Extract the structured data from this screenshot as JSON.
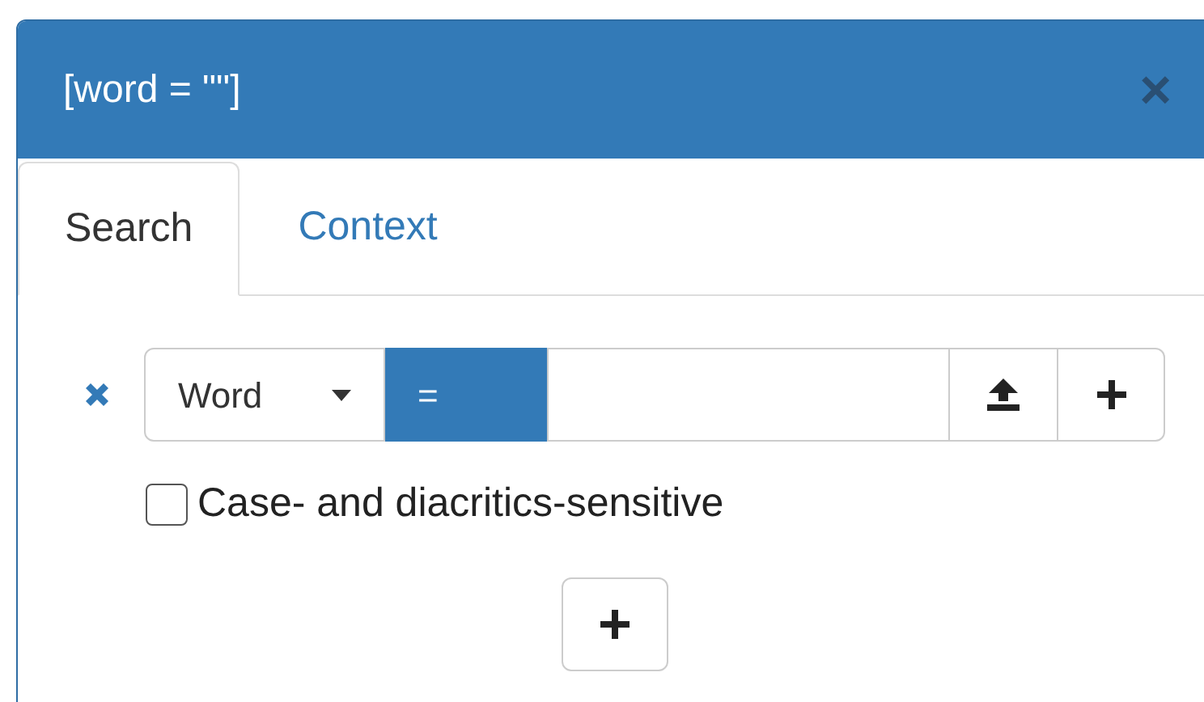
{
  "dialog": {
    "title": "[word = \"\"]",
    "close": "×"
  },
  "tabs": [
    {
      "label": "Search",
      "selected": true
    },
    {
      "label": "Context",
      "selected": false
    }
  ],
  "condition": {
    "field": "Word",
    "operator": "="
  },
  "option": {
    "label": "Case- and diacritics-sensitive",
    "checked": false
  }
}
